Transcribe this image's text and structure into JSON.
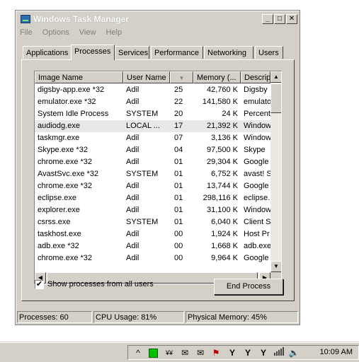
{
  "window": {
    "title": "Windows Task Manager",
    "controls": {
      "minimize": "_",
      "maximize": "□",
      "close": "✕"
    }
  },
  "menu": [
    "File",
    "Options",
    "View",
    "Help"
  ],
  "tabs": [
    "Applications",
    "Processes",
    "Services",
    "Performance",
    "Networking",
    "Users"
  ],
  "active_tab": "Processes",
  "columns": [
    "Image Name",
    "User Name",
    "",
    "Memory (...",
    "Descrip"
  ],
  "processes": [
    {
      "name": "digsby-app.exe *32",
      "user": "Adil",
      "cpu": "25",
      "mem": "42,760 K",
      "desc": "Digsby"
    },
    {
      "name": "emulator.exe *32",
      "user": "Adil",
      "cpu": "22",
      "mem": "141,580 K",
      "desc": "emulato"
    },
    {
      "name": "System Idle Process",
      "user": "SYSTEM",
      "cpu": "20",
      "mem": "24 K",
      "desc": "Percent"
    },
    {
      "name": "audiodg.exe",
      "user": "LOCAL ...",
      "cpu": "17",
      "mem": "21,392 K",
      "desc": "Window"
    },
    {
      "name": "taskmgr.exe",
      "user": "Adil",
      "cpu": "07",
      "mem": "3,136 K",
      "desc": "Window"
    },
    {
      "name": "Skype.exe *32",
      "user": "Adil",
      "cpu": "04",
      "mem": "97,500 K",
      "desc": "Skype"
    },
    {
      "name": "chrome.exe *32",
      "user": "Adil",
      "cpu": "01",
      "mem": "29,304 K",
      "desc": "Google"
    },
    {
      "name": "AvastSvc.exe *32",
      "user": "SYSTEM",
      "cpu": "01",
      "mem": "6,752 K",
      "desc": "avast! S"
    },
    {
      "name": "chrome.exe *32",
      "user": "Adil",
      "cpu": "01",
      "mem": "13,744 K",
      "desc": "Google"
    },
    {
      "name": "eclipse.exe",
      "user": "Adil",
      "cpu": "01",
      "mem": "298,116 K",
      "desc": "eclipse."
    },
    {
      "name": "explorer.exe",
      "user": "Adil",
      "cpu": "01",
      "mem": "31,100 K",
      "desc": "Window"
    },
    {
      "name": "csrss.exe",
      "user": "SYSTEM",
      "cpu": "01",
      "mem": "6,040 K",
      "desc": "Client S"
    },
    {
      "name": "taskhost.exe",
      "user": "Adil",
      "cpu": "00",
      "mem": "1,924 K",
      "desc": "Host Pr"
    },
    {
      "name": "adb.exe *32",
      "user": "Adil",
      "cpu": "00",
      "mem": "1,668 K",
      "desc": "adb.exe"
    },
    {
      "name": "chrome.exe *32",
      "user": "Adil",
      "cpu": "00",
      "mem": "9,964 K",
      "desc": "Google"
    }
  ],
  "selected_row": 3,
  "show_all_label": "Show processes from all users",
  "show_all_checked": "✔",
  "end_process_label": "End Process",
  "status": {
    "processes": "Processes: 60",
    "cpu": "CPU Usage: 81%",
    "memory": "Physical Memory: 45%"
  },
  "taskbar": {
    "clock": "10:09 AM",
    "tray_icons": [
      "expand-arrow",
      "green-square",
      "network-monitor",
      "mail",
      "mail",
      "skype-notify",
      "yahoo",
      "yahoo",
      "yahoo-alt",
      "signal-bars",
      "speaker"
    ]
  }
}
